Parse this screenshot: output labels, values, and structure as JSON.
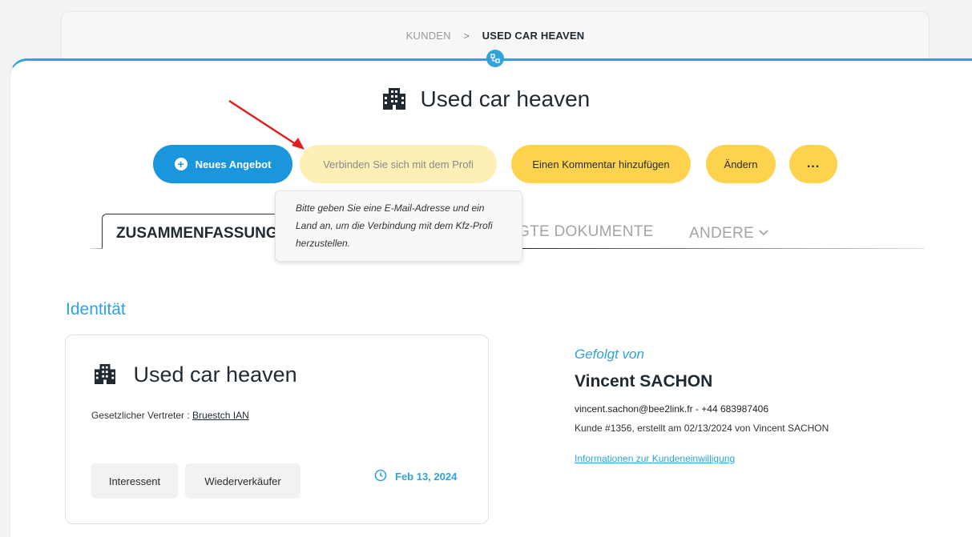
{
  "breadcrumb": {
    "root": "KUNDEN",
    "separator": ">",
    "current": "USED CAR HEAVEN"
  },
  "header": {
    "title": "Used car heaven"
  },
  "actions": {
    "new_offer": "Neues Angebot",
    "connect_pro": "Verbinden Sie sich mit dem Profi",
    "add_comment": "Einen Kommentar hinzufügen",
    "edit": "Ändern",
    "more": "..."
  },
  "tooltip": {
    "text": "Bitte geben Sie eine E-Mail-Adresse und ein Land an, um die Verbindung mit dem Kfz-Profi herzustellen."
  },
  "tabs": [
    {
      "label": "ZUSAMMENFASSUNG",
      "active": true
    },
    {
      "label": "GTE DOKUMENTE",
      "active": false
    },
    {
      "label": "ANDERE",
      "active": false
    }
  ],
  "identity": {
    "section_title": "Identität",
    "name": "Used car heaven",
    "legal_label": "Gesetzlicher Vertreter : ",
    "legal_name": "Bruestch IAN",
    "tags": [
      "Interessent",
      "Wiederverkäufer"
    ],
    "date": "Feb 13, 2024"
  },
  "followed": {
    "label": "Gefolgt von",
    "name": "Vincent SACHON",
    "contact": "vincent.sachon@bee2link.fr - +44 683987406",
    "client_info": "Kunde #1356, erstellt am 02/13/2024 von Vincent SACHON",
    "consent_link": "Informationen zur Kundeneinwilligung"
  },
  "colors": {
    "accent": "#2ea3dc",
    "primary_button": "#1a96dc",
    "yellow_button": "#fdd34e",
    "disabled_button": "#fdefb5",
    "arrow": "#e02020"
  },
  "icons": {
    "building": "building-icon",
    "hub": "hierarchy-icon",
    "plus": "plus-circle-icon",
    "clock": "clock-icon",
    "chevron": "chevron-down-icon"
  }
}
